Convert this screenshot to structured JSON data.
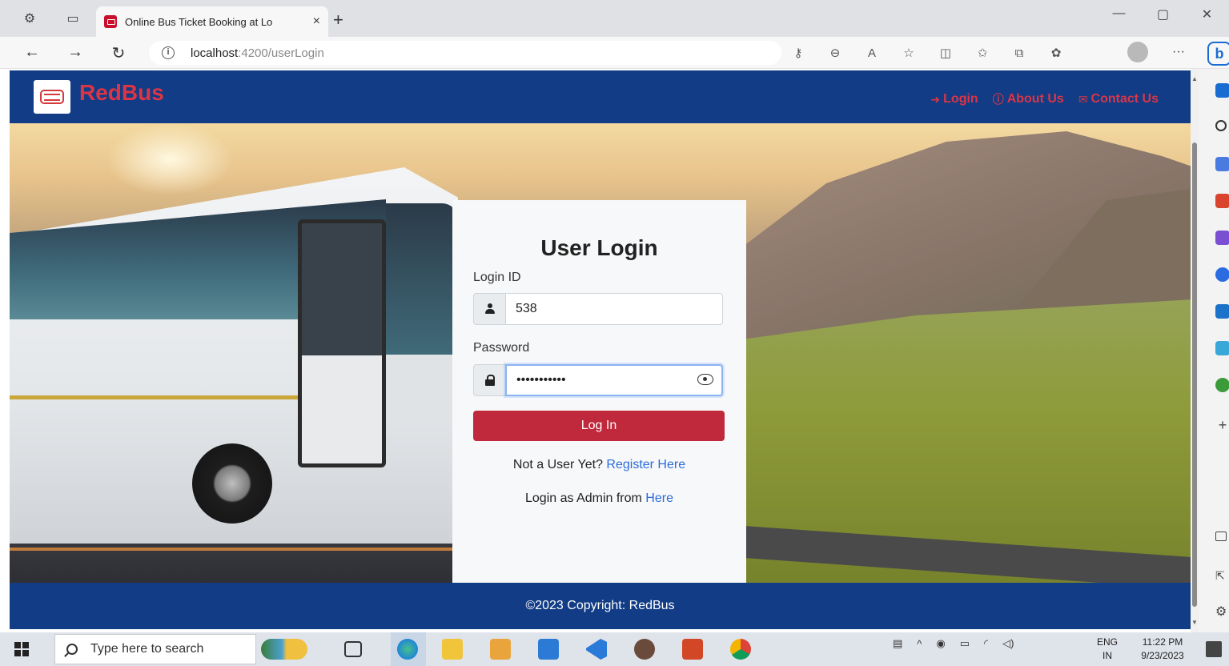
{
  "browser": {
    "tab_title": "Online Bus Ticket Booking at Lo",
    "tab_close": "×",
    "new_tab": "+",
    "url_host": "localhost",
    "url_path": ":4200/userLogin",
    "info_glyph": "i",
    "more_glyph": "···",
    "bing_glyph": "b"
  },
  "app": {
    "brand": "RedBus",
    "nav": [
      {
        "label": "Login",
        "icon": "login-icon"
      },
      {
        "label": "About Us",
        "icon": "info-icon"
      },
      {
        "label": "Contact Us",
        "icon": "envelope-icon"
      }
    ],
    "colors": {
      "navbar": "#123c85",
      "brand_red": "#dc3545",
      "button": "#c0283b",
      "link": "#2a6bd9"
    }
  },
  "login": {
    "title": "User Login",
    "login_id_label": "Login ID",
    "login_id_value": "538",
    "password_label": "Password",
    "password_value": "•••••••••••",
    "submit": "Log In",
    "register_prompt": "Not a User Yet? ",
    "register_link": "Register Here",
    "admin_prompt": "Login as Admin from ",
    "admin_link": "Here"
  },
  "footer": {
    "text": "©2023 Copyright: RedBus"
  },
  "taskbar": {
    "search_placeholder": "Type here to search",
    "lang_1": "ENG",
    "lang_2": "IN",
    "time": "11:22 PM",
    "date": "9/23/2023"
  }
}
